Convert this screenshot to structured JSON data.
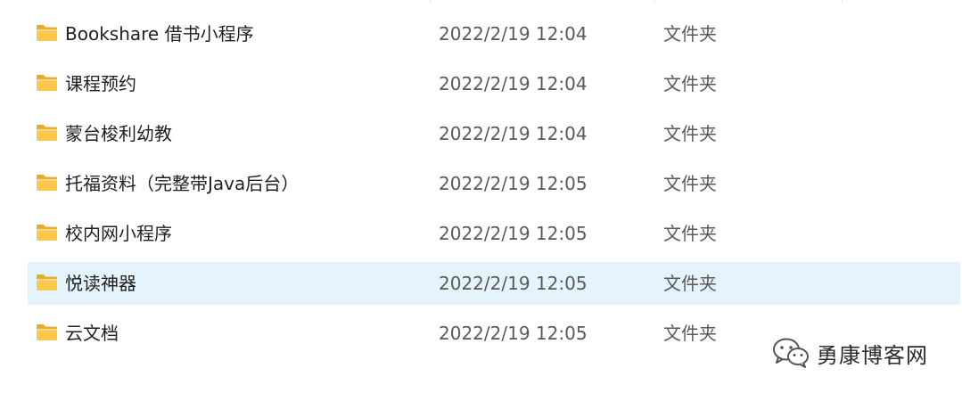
{
  "rows": [
    {
      "name": "Bookshare 借书小程序",
      "date": "2022/2/19 12:04",
      "type": "文件夹",
      "selected": false
    },
    {
      "name": "课程预约",
      "date": "2022/2/19 12:04",
      "type": "文件夹",
      "selected": false
    },
    {
      "name": "蒙台梭利幼教",
      "date": "2022/2/19 12:04",
      "type": "文件夹",
      "selected": false
    },
    {
      "name": "托福资料（完整带Java后台）",
      "date": "2022/2/19 12:05",
      "type": "文件夹",
      "selected": false
    },
    {
      "name": "校内网小程序",
      "date": "2022/2/19 12:05",
      "type": "文件夹",
      "selected": false
    },
    {
      "name": "悦读神器",
      "date": "2022/2/19 12:05",
      "type": "文件夹",
      "selected": true
    },
    {
      "name": "云文档",
      "date": "2022/2/19 12:05",
      "type": "文件夹",
      "selected": false
    }
  ],
  "icons": {
    "row_icon": "folder-icon",
    "watermark_icon": "wechat-icon"
  },
  "colors": {
    "selection": "#e5f3fd",
    "folder": "#f8c94a"
  },
  "watermark": {
    "text": "勇康博客网"
  }
}
